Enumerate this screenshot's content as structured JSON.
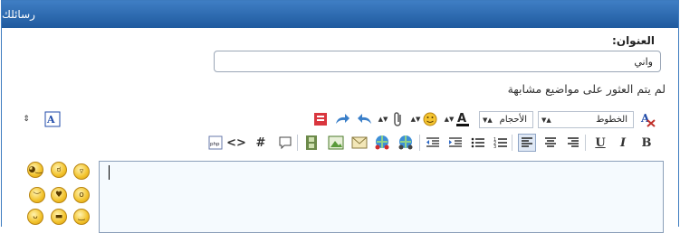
{
  "header": {
    "title": "رسائلك"
  },
  "subject": {
    "label": "العنوان:",
    "value": "واني"
  },
  "notice": "لم يتم العثور على مواضيع مشابهة",
  "toolbar": {
    "font_select": "الخطوط",
    "size_select": "الأحجام",
    "row1_icons": [
      "remove-format-icon",
      "font-select",
      "size-select",
      "text-color-icon",
      "smiley-icon",
      "attach-icon",
      "undo-icon",
      "redo-icon",
      "delete-icon"
    ],
    "row2_icons": [
      "bold-icon",
      "italic-icon",
      "underline-icon",
      "align-right-icon",
      "align-center-icon",
      "align-left-icon",
      "ordered-list-icon",
      "unordered-list-icon",
      "indent-icon",
      "outdent-icon",
      "link-icon",
      "unlink-icon",
      "email-icon",
      "image-icon",
      "video-icon",
      "quote-icon",
      "code-hash-icon",
      "html-icon",
      "php-icon"
    ],
    "side_icons": [
      "resize-arrows-icon",
      "switch-mode-icon"
    ]
  },
  "colors": {
    "header_top": "#3f7ec4",
    "header_bottom": "#1f5a9e",
    "editor_bg": "#f5fafe"
  },
  "smileys": [
    "smiley-grin",
    "smiley-sick",
    "smiley-wink",
    "smiley-shocked",
    "smiley-love",
    "smiley-angry",
    "smiley-happy",
    "smiley-cool",
    "smiley-devil"
  ]
}
